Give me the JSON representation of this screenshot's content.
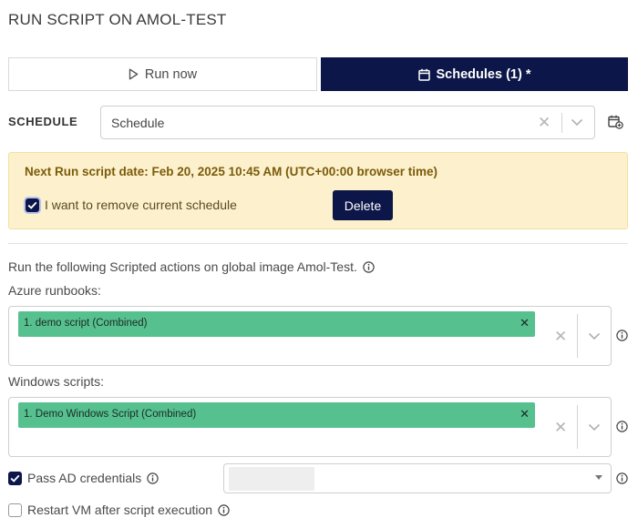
{
  "title": "RUN SCRIPT ON AMOL-TEST",
  "tabs": {
    "run_now": "Run now",
    "schedules": "Schedules (1) *"
  },
  "schedule": {
    "label": "SCHEDULE",
    "value": "Schedule"
  },
  "banner": {
    "next_run": "Next Run script date: Feb 20, 2025 10:45 AM (UTC+00:00 browser time)",
    "remove_label": "I want to remove current schedule",
    "remove_checked": true,
    "delete_button": "Delete"
  },
  "description": "Run the following Scripted actions on global image Amol-Test.",
  "azure": {
    "label": "Azure runbooks:",
    "selected": [
      "1. demo script (Combined)"
    ]
  },
  "windows": {
    "label": "Windows scripts:",
    "selected": [
      "1. Demo Windows Script (Combined)"
    ]
  },
  "pass_ad": {
    "label": "Pass AD credentials",
    "checked": true
  },
  "restart_vm": {
    "label": "Restart VM after script execution",
    "checked": false
  },
  "colors": {
    "primary": "#0c1648",
    "tag": "#56c08f",
    "banner_bg": "#fdf1cd",
    "banner_text": "#7a5b0a"
  },
  "icons": [
    "play-icon",
    "calendar-icon",
    "calendar-add-icon",
    "clear-icon",
    "chevron-down-icon",
    "info-icon",
    "check-icon",
    "dropdown-arrow-icon"
  ]
}
